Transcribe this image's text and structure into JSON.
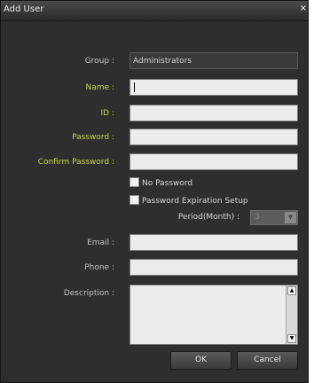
{
  "dialog": {
    "title": "Add User",
    "close": "×"
  },
  "form": {
    "group_label": "Group :",
    "group_value": "Administrators",
    "name_label": "Name :",
    "id_label": "ID :",
    "password_label": "Password :",
    "confirm_password_label": "Confirm Password :",
    "no_password_label": "No Password",
    "password_expiration_label": "Password Expiration Setup",
    "period_label": "Period(Month) :",
    "period_value": "3",
    "email_label": "Email :",
    "phone_label": "Phone :",
    "description_label": "Description :"
  },
  "buttons": {
    "ok": "OK",
    "cancel": "Cancel"
  },
  "colors": {
    "required_label": "#c8d84a",
    "label": "#c4c4c4",
    "background": "#2e2e2e"
  }
}
